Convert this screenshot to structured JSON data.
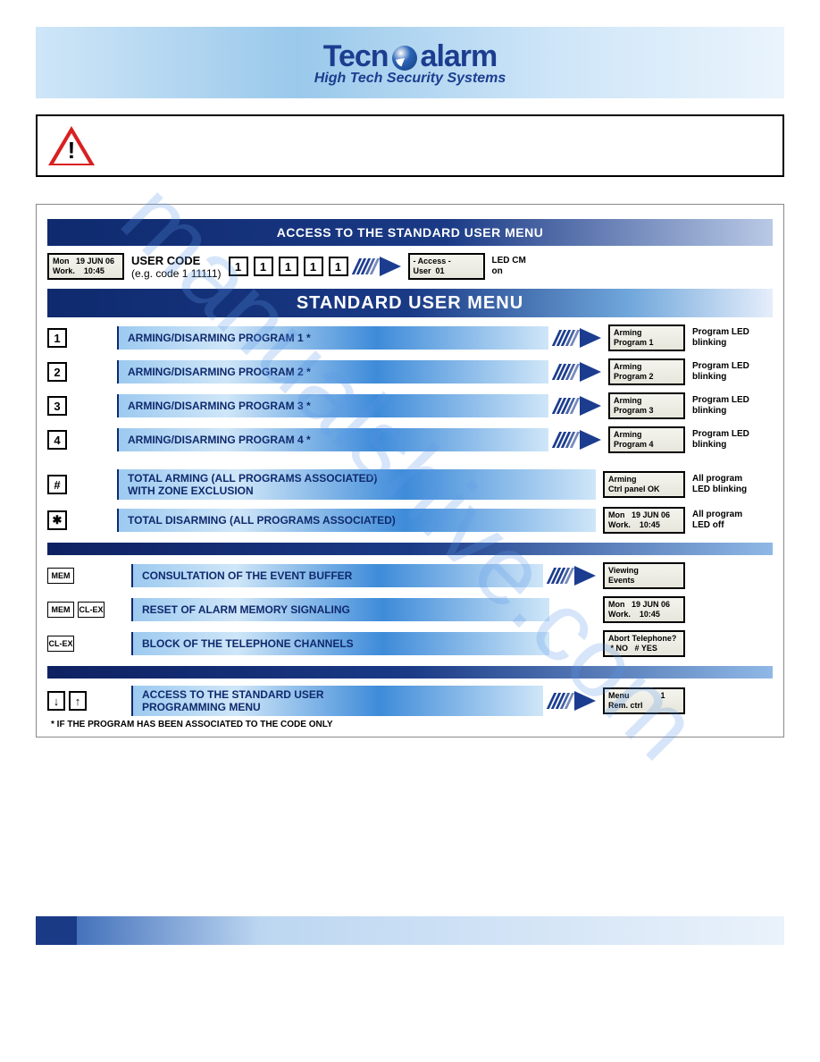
{
  "header": {
    "brand_left": "Tecn",
    "brand_right": "alarm",
    "tagline": "High Tech Security Systems"
  },
  "frame": {
    "access_title": "ACCESS TO THE STANDARD USER MENU",
    "standard_menu_title": "STANDARD USER MENU",
    "footnote": "* IF THE PROGRAM HAS BEEN ASSOCIATED TO THE CODE ONLY"
  },
  "access_row": {
    "lcd_home": "Mon   19 JUN 06\nWork.    10:45",
    "label": "USER CODE",
    "sub": "(e.g. code 1 11111)",
    "keys": [
      "1",
      "1",
      "1",
      "1",
      "1"
    ],
    "lcd_access": "- Access -\nUser  01",
    "status": "LED CM\non"
  },
  "programs": [
    {
      "key": "1",
      "label": "ARMING/DISARMING PROGRAM 1 *",
      "lcd": "Arming\nProgram 1",
      "status": "Program LED\nblinking"
    },
    {
      "key": "2",
      "label": "ARMING/DISARMING PROGRAM 2 *",
      "lcd": "Arming\nProgram 2",
      "status": "Program LED\nblinking"
    },
    {
      "key": "3",
      "label": "ARMING/DISARMING PROGRAM 3 *",
      "lcd": "Arming\nProgram 3",
      "status": "Program LED\nblinking"
    },
    {
      "key": "4",
      "label": "ARMING/DISARMING PROGRAM 4 *",
      "lcd": "Arming\nProgram 4",
      "status": "Program LED\nblinking"
    }
  ],
  "totals": [
    {
      "key": "#",
      "label": "TOTAL ARMING (ALL PROGRAMS ASSOCIATED)\nWITH ZONE EXCLUSION",
      "lcd": "Arming\nCtrl panel OK",
      "status": "All program\nLED blinking"
    },
    {
      "key": "✱",
      "label": "TOTAL DISARMING (ALL PROGRAMS ASSOCIATED)",
      "lcd": "Mon   19 JUN 06\nWork.    10:45",
      "status": "All program\nLED off"
    }
  ],
  "functions": [
    {
      "keys": [
        "MEM"
      ],
      "label": "CONSULTATION OF THE EVENT BUFFER",
      "lcd": "Viewing\nEvents",
      "show_arrow": true
    },
    {
      "keys": [
        "MEM",
        "CL-EX"
      ],
      "label": "RESET OF ALARM MEMORY SIGNALING",
      "lcd": "Mon   19 JUN 06\nWork.    10:45",
      "show_arrow": false
    },
    {
      "keys": [
        "CL-EX"
      ],
      "label": "BLOCK OF THE TELEPHONE CHANNELS",
      "lcd": "Abort Telephone?\n * NO   # YES",
      "show_arrow": false
    }
  ],
  "prog_menu": {
    "keys": [
      "↓",
      "↑"
    ],
    "label": "ACCESS TO THE STANDARD USER\nPROGRAMMING MENU",
    "lcd": "Menu              1\nRem. ctrl"
  },
  "watermark": "manualshive.com"
}
